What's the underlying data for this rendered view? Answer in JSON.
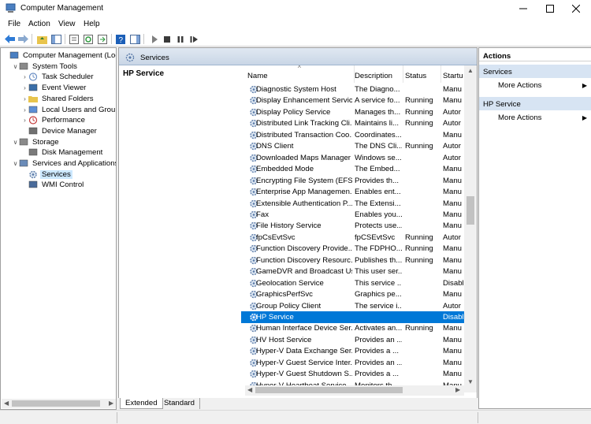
{
  "window": {
    "title": "Computer Management"
  },
  "menu": {
    "items": [
      "File",
      "Action",
      "View",
      "Help"
    ]
  },
  "tree": {
    "items": [
      {
        "label": "Computer Management (Local",
        "indent": 0,
        "arrow": "",
        "icon": "computer-icon"
      },
      {
        "label": "System Tools",
        "indent": 1,
        "arrow": "down",
        "icon": "tools-icon"
      },
      {
        "label": "Task Scheduler",
        "indent": 2,
        "arrow": "right",
        "icon": "clock-icon"
      },
      {
        "label": "Event Viewer",
        "indent": 2,
        "arrow": "right",
        "icon": "event-viewer-icon"
      },
      {
        "label": "Shared Folders",
        "indent": 2,
        "arrow": "right",
        "icon": "folder-icon"
      },
      {
        "label": "Local Users and Groups",
        "indent": 2,
        "arrow": "right",
        "icon": "users-icon"
      },
      {
        "label": "Performance",
        "indent": 2,
        "arrow": "right",
        "icon": "performance-icon"
      },
      {
        "label": "Device Manager",
        "indent": 2,
        "arrow": "",
        "icon": "device-manager-icon"
      },
      {
        "label": "Storage",
        "indent": 1,
        "arrow": "down",
        "icon": "storage-icon"
      },
      {
        "label": "Disk Management",
        "indent": 2,
        "arrow": "",
        "icon": "disk-icon"
      },
      {
        "label": "Services and Applications",
        "indent": 1,
        "arrow": "down",
        "icon": "services-apps-icon"
      },
      {
        "label": "Services",
        "indent": 2,
        "arrow": "",
        "icon": "gear-icon",
        "selected": true
      },
      {
        "label": "WMI Control",
        "indent": 2,
        "arrow": "",
        "icon": "wmi-icon"
      }
    ]
  },
  "center": {
    "header": "Services",
    "description_title": "HP Service",
    "columns": [
      "Name",
      "Description",
      "Status",
      "Startu"
    ],
    "rows": [
      {
        "name": "Diagnostic System Host",
        "desc": "The Diagno...",
        "status": "",
        "startup": "Manu"
      },
      {
        "name": "Display Enhancement Service",
        "desc": "A service fo...",
        "status": "Running",
        "startup": "Manu"
      },
      {
        "name": "Display Policy Service",
        "desc": "Manages th...",
        "status": "Running",
        "startup": "Autor"
      },
      {
        "name": "Distributed Link Tracking Cli...",
        "desc": "Maintains li...",
        "status": "Running",
        "startup": "Autor"
      },
      {
        "name": "Distributed Transaction Coo...",
        "desc": "Coordinates...",
        "status": "",
        "startup": "Manu"
      },
      {
        "name": "DNS Client",
        "desc": "The DNS Cli...",
        "status": "Running",
        "startup": "Autor"
      },
      {
        "name": "Downloaded Maps Manager",
        "desc": "Windows se...",
        "status": "",
        "startup": "Autor"
      },
      {
        "name": "Embedded Mode",
        "desc": "The Embed...",
        "status": "",
        "startup": "Manu"
      },
      {
        "name": "Encrypting File System (EFS)",
        "desc": "Provides th...",
        "status": "",
        "startup": "Manu"
      },
      {
        "name": "Enterprise App Managemen...",
        "desc": "Enables ent...",
        "status": "",
        "startup": "Manu"
      },
      {
        "name": "Extensible Authentication P...",
        "desc": "The Extensi...",
        "status": "",
        "startup": "Manu"
      },
      {
        "name": "Fax",
        "desc": "Enables you...",
        "status": "",
        "startup": "Manu"
      },
      {
        "name": "File History Service",
        "desc": "Protects use...",
        "status": "",
        "startup": "Manu"
      },
      {
        "name": "fpCsEvtSvc",
        "desc": "fpCSEvtSvc",
        "status": "Running",
        "startup": "Autor"
      },
      {
        "name": "Function Discovery Provide...",
        "desc": "The FDPHO...",
        "status": "Running",
        "startup": "Manu"
      },
      {
        "name": "Function Discovery Resourc...",
        "desc": "Publishes th...",
        "status": "Running",
        "startup": "Manu"
      },
      {
        "name": "GameDVR and Broadcast Us...",
        "desc": "This user ser...",
        "status": "",
        "startup": "Manu"
      },
      {
        "name": "Geolocation Service",
        "desc": "This service ...",
        "status": "",
        "startup": "Disabl"
      },
      {
        "name": "GraphicsPerfSvc",
        "desc": "Graphics pe...",
        "status": "",
        "startup": "Manu"
      },
      {
        "name": "Group Policy Client",
        "desc": "The service i...",
        "status": "",
        "startup": "Autor"
      },
      {
        "name": "HP Service",
        "desc": "",
        "status": "",
        "startup": "Disabl",
        "selected": true
      },
      {
        "name": "Human Interface Device Ser...",
        "desc": "Activates an...",
        "status": "Running",
        "startup": "Manu"
      },
      {
        "name": "HV Host Service",
        "desc": "Provides an ...",
        "status": "",
        "startup": "Manu"
      },
      {
        "name": "Hyper-V Data Exchange Ser...",
        "desc": "Provides a ...",
        "status": "",
        "startup": "Manu"
      },
      {
        "name": "Hyper-V Guest Service Inter...",
        "desc": "Provides an ...",
        "status": "",
        "startup": "Manu"
      },
      {
        "name": "Hyper-V Guest Shutdown S...",
        "desc": "Provides a ...",
        "status": "",
        "startup": "Manu"
      },
      {
        "name": "Hyper-V Heartbeat Service",
        "desc": "Monitors th...",
        "status": "",
        "startup": "Manu"
      }
    ],
    "tabs": [
      "Extended",
      "Standard"
    ]
  },
  "actions": {
    "title": "Actions",
    "sections": [
      {
        "label": "Services",
        "item": "More Actions"
      },
      {
        "label": "HP Service",
        "item": "More Actions"
      }
    ]
  },
  "colors": {
    "selection": "#0078d7",
    "tree_selection": "#cce8ff",
    "section_bg": "#d7e4f3"
  }
}
